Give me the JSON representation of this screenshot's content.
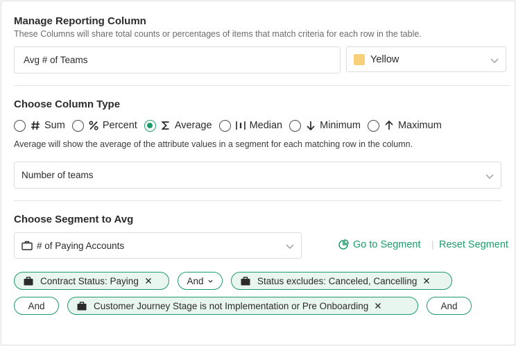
{
  "header": {
    "title": "Manage Reporting Column",
    "subtitle": "These Columns will share total counts or percentages of items that match criteria for each row in the table."
  },
  "column_name_input": {
    "value": "Avg # of Teams"
  },
  "color_select": {
    "value": "Yellow",
    "swatch_color": "#f9d07a"
  },
  "column_type": {
    "title": "Choose Column Type",
    "options": [
      {
        "label": "Sum",
        "icon": "hash-icon",
        "selected": false
      },
      {
        "label": "Percent",
        "icon": "percent-icon",
        "selected": false
      },
      {
        "label": "Average",
        "icon": "sigma-icon",
        "selected": true
      },
      {
        "label": "Median",
        "icon": "median-icon",
        "selected": false
      },
      {
        "label": "Minimum",
        "icon": "arrow-down-icon",
        "selected": false
      },
      {
        "label": "Maximum",
        "icon": "arrow-up-icon",
        "selected": false
      }
    ],
    "help_text": "Average will show the average of the attribute values in a segment for each matching row in the column."
  },
  "attribute_select": {
    "value": "Number of teams"
  },
  "segment": {
    "title": "Choose Segment to Avg",
    "select_value": "# of Paying Accounts",
    "go_to_label": "Go to Segment",
    "reset_label": "Reset Segment",
    "separator": "|"
  },
  "filters": {
    "chip_1": "Contract Status: Paying",
    "conjunction_1": "And",
    "chip_2": "Status excludes: Canceled, Cancelling",
    "conjunction_2": "And",
    "chip_3": "Customer Journey Stage is not Implementation or Pre Onboarding",
    "conjunction_3": "And"
  },
  "colors": {
    "accent": "#1e9b6b",
    "accent_bg": "#e9f6ef",
    "border": "#dcdcdc"
  }
}
